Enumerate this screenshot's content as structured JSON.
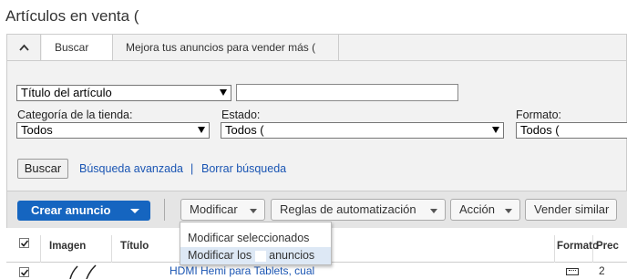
{
  "page": {
    "title": "Artículos en venta ("
  },
  "tabs": [
    {
      "label": "Buscar"
    },
    {
      "label": "Mejora tus anuncios para vender más ("
    }
  ],
  "filters": {
    "title_field": {
      "selected": "Título del artículo",
      "value": ""
    },
    "category": {
      "label": "Categoría de la tienda:",
      "selected": "Todos"
    },
    "status": {
      "label": "Estado:",
      "selected": "Todos ("
    },
    "format": {
      "label": "Formato:",
      "selected": "Todos ("
    },
    "search_button": "Buscar",
    "advanced_link": "Búsqueda avanzada",
    "separator": "|",
    "clear_link": "Borrar búsqueda"
  },
  "toolbar": {
    "create_label": "Crear anuncio",
    "modify_label": "Modificar",
    "rules_label": "Reglas de automatización",
    "action_label": "Acción",
    "sell_similar_label": "Vender similar"
  },
  "modify_menu": {
    "items": [
      {
        "label": "Modificar seleccionados"
      },
      {
        "label_pre": "Modificar los",
        "label_post": "anuncios"
      }
    ]
  },
  "table": {
    "headers": {
      "image": "Imagen",
      "title": "Título",
      "format": "Formato",
      "price": "Prec"
    },
    "rows": [
      {
        "title": "HDMI Hemi para Tablets, cual"
      }
    ]
  },
  "colors": {
    "primary": "#1565c0",
    "link": "#1a55b3",
    "menu_hover": "#dde8f5"
  }
}
